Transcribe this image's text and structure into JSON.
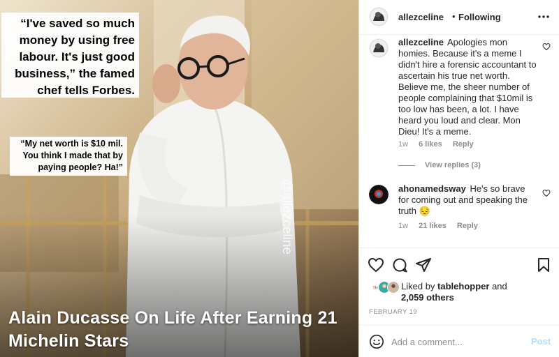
{
  "media": {
    "quote_main": "“I've saved so much money by using free labour. It's just good business,” the famed chef tells Forbes.",
    "quote_secondary": "“My net worth is $10 mil. You think I made that by paying people? Ha!”",
    "watermark": "@allezceline",
    "headline": "Alain Ducasse On Life After Earning 21 Michelin Stars"
  },
  "header": {
    "username": "allezceline",
    "separator": "•",
    "follow_status": "Following",
    "more_icon": "more-horizontal-icon"
  },
  "comments": [
    {
      "username": "allezceline",
      "text": "Apologies mon homies. Because it's a meme I didn't hire a forensic accountant to ascertain his true net worth. Believe me, the sheer number of people complaining that $10mil is too low has been, a lot. I have heard you loud and clear. Mon Dieu! It's a meme.",
      "time": "1w",
      "likes": "6 likes",
      "reply": "Reply",
      "view_replies": "View replies (3)"
    },
    {
      "username": "ahonamedsway",
      "text": "He's so brave for coming out and speaking the truth 😔",
      "time": "1w",
      "likes": "21 likes",
      "reply": "Reply"
    }
  ],
  "actions": {
    "like_icon": "heart-icon",
    "comment_icon": "comment-icon",
    "share_icon": "share-icon",
    "save_icon": "bookmark-icon"
  },
  "likes": {
    "prefix": "Liked by ",
    "user": "tablehopper",
    "middle": " and",
    "count": "2,059 others"
  },
  "date": "FEBRUARY 19",
  "comment_box": {
    "placeholder": "Add a comment...",
    "post_label": "Post"
  },
  "colors": {
    "post_disabled": "#b2dffc",
    "muted": "#8e8e8e",
    "text": "#262626"
  }
}
